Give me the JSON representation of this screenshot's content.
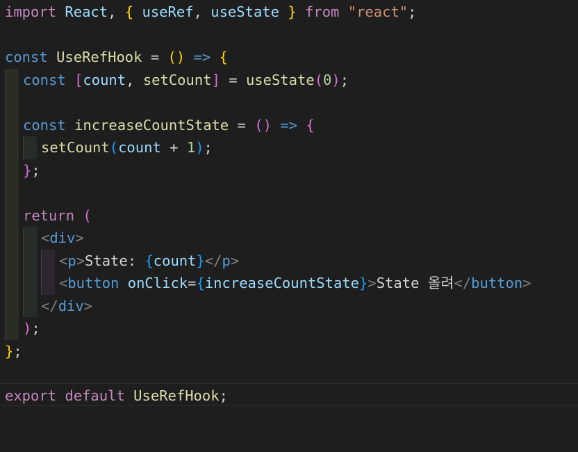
{
  "editor": {
    "language": "javascript-react",
    "colors": {
      "background": "#1e1e1e",
      "keyword": "#569cd6",
      "control_keyword": "#c586c0",
      "function": "#dcdcaa",
      "variable": "#9cdcfe",
      "string": "#ce9178",
      "number": "#b5cea8",
      "bracket_level1": "#ffd700",
      "bracket_level2": "#da70d6",
      "bracket_level3": "#179fff"
    },
    "lines": [
      "import React, { useRef, useState } from \"react\";",
      "",
      "const UseRefHook = () => {",
      "  const [count, setCount] = useState(0);",
      "",
      "  const increaseCountState = () => {",
      "    setCount(count + 1);",
      "  };",
      "",
      "  return (",
      "    <div>",
      "      <p>State: {count}</p>",
      "      <button onClick={increaseCountState}>State 올려</button>",
      "    </div>",
      "  );",
      "};",
      "",
      "export default UseRefHook;"
    ],
    "tokens": {
      "l1": {
        "import": "import",
        "react_id": "React",
        "comma": ", ",
        "brace_open": "{",
        "useRef": "useRef",
        "comma2": ", ",
        "useState": "useState",
        "brace_close": "}",
        "from": "from",
        "module": "\"react\"",
        "semi": ";"
      },
      "l3": {
        "const": "const",
        "name": "UseRefHook",
        "eq": " = ",
        "paren": "()",
        "arrow": "=>",
        "brace": "{"
      },
      "l4": {
        "const": "const",
        "bracket_open": "[",
        "count": "count",
        "comma": ", ",
        "setCount": "setCount",
        "bracket_close": "]",
        "eq": " = ",
        "useState": "useState",
        "paren_open": "(",
        "zero": "0",
        "paren_close": ")",
        "semi": ";"
      },
      "l6": {
        "const": "const",
        "name": "increaseCountState",
        "eq": " = ",
        "paren": "()",
        "arrow": "=>",
        "brace": "{"
      },
      "l7": {
        "setCount": "setCount",
        "paren_open": "(",
        "count": "count",
        "plus": " + ",
        "one": "1",
        "paren_close": ")",
        "semi": ";"
      },
      "l8": {
        "brace": "}",
        "semi": ";"
      },
      "l10": {
        "return": "return",
        "paren": "("
      },
      "l11": {
        "lt": "<",
        "div": "div",
        "gt": ">"
      },
      "l12": {
        "lt": "<",
        "p": "p",
        "gt": ">",
        "text": "State: ",
        "brace_open": "{",
        "count": "count",
        "brace_close": "}",
        "lt_close": "</",
        "p_close": "p",
        "gt_close": ">"
      },
      "l13": {
        "lt": "<",
        "button": "button",
        "onClick": "onClick",
        "eq": "=",
        "brace_open": "{",
        "handler": "increaseCountState",
        "brace_close": "}",
        "gt": ">",
        "text": "State 올려",
        "lt_close": "</",
        "button_close": "button",
        "gt_close": ">"
      },
      "l14": {
        "lt_close": "</",
        "div": "div",
        "gt": ">"
      },
      "l15": {
        "paren": ")",
        "semi": ";"
      },
      "l16": {
        "brace": "}",
        "semi": ";"
      },
      "l18": {
        "export": "export",
        "default": "default",
        "name": "UseRefHook",
        "semi": ";"
      }
    }
  }
}
